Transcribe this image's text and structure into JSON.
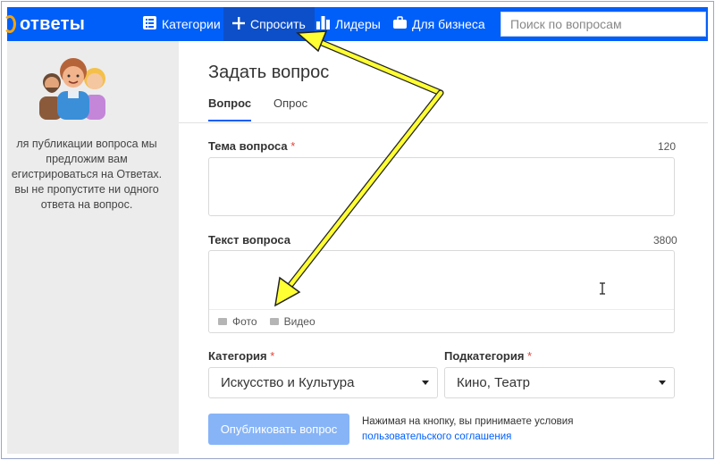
{
  "header": {
    "logo_text": "ответы",
    "nav": [
      {
        "label": "Категории",
        "icon": "list-icon"
      },
      {
        "label": "Спросить",
        "icon": "plus-icon",
        "active": true
      },
      {
        "label": "Лидеры",
        "icon": "bar-chart-icon"
      },
      {
        "label": "Для бизнеса",
        "icon": "briefcase-icon"
      }
    ],
    "search_placeholder": "Поиск по вопросам"
  },
  "sidebar": {
    "text": "ля публикации вопроса мы предложим вам егистрироваться на Ответах. вы не пропустите ни одного ответа на вопрос."
  },
  "form": {
    "title": "Задать вопрос",
    "tabs": [
      {
        "label": "Вопрос",
        "active": true
      },
      {
        "label": "Опрос",
        "active": false
      }
    ],
    "topic_label": "Тема вопроса",
    "topic_limit": "120",
    "text_label": "Текст вопроса",
    "text_limit": "3800",
    "required_mark": "*",
    "photo_label": "Фото",
    "video_label": "Видео",
    "category_label": "Категория",
    "category_value": "Искусство и Культура",
    "subcategory_label": "Подкатегория",
    "subcategory_value": "Кино, Театр",
    "publish_label": "Опубликовать вопрос",
    "terms_text": "Нажимая на кнопку, вы принимаете условия",
    "terms_link": "пользовательского соглашения"
  },
  "colors": {
    "brand_blue": "#005ff9",
    "active_nav": "#0d4fc9",
    "publish_disabled": "#87b4f7",
    "required_red": "#e0453d",
    "annotation_arrow": "#ffff33"
  }
}
